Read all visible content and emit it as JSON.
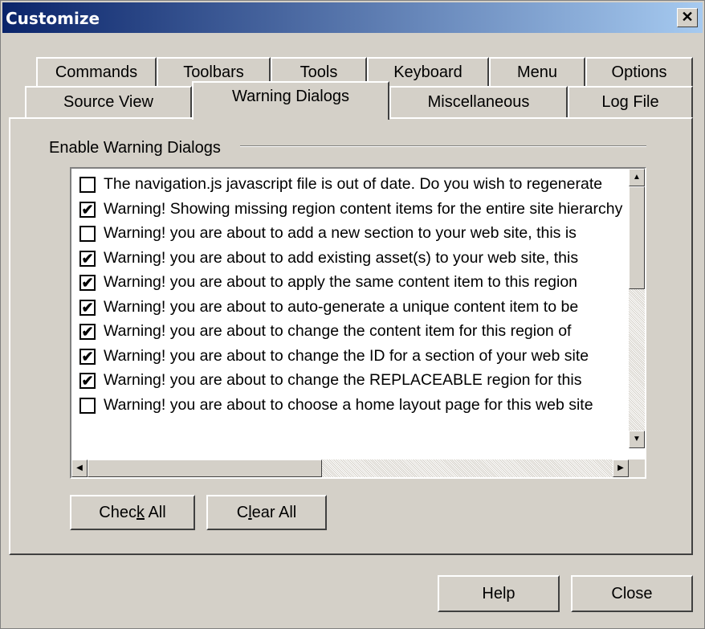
{
  "window": {
    "title": "Customize",
    "close_glyph": "✕"
  },
  "tabs_row1": [
    "Commands",
    "Toolbars",
    "Tools",
    "Keyboard",
    "Menu",
    "Options"
  ],
  "tabs_row2": [
    "Source View",
    "Warning Dialogs",
    "Miscellaneous",
    "Log File"
  ],
  "active_tab": "Warning Dialogs",
  "group": {
    "label": "Enable Warning Dialogs"
  },
  "items": [
    {
      "checked": false,
      "text": "The navigation.js javascript file is out of date. Do you wish to regenerate"
    },
    {
      "checked": true,
      "text": "Warning! Showing missing region content items for the entire site hierarchy"
    },
    {
      "checked": false,
      "text": "Warning! you are about to add a new section to your web site, this is"
    },
    {
      "checked": true,
      "text": "Warning! you are about to add existing asset(s) to your web site, this"
    },
    {
      "checked": true,
      "text": "Warning! you are about to apply the same content item to this region"
    },
    {
      "checked": true,
      "text": "Warning! you are about to auto-generate a unique content item to be"
    },
    {
      "checked": true,
      "text": "Warning! you are about to change the content item for this region of"
    },
    {
      "checked": true,
      "text": "Warning! you are about to change the ID for a section of your web site"
    },
    {
      "checked": true,
      "text": "Warning! you are about to change the REPLACEABLE region for this"
    },
    {
      "checked": false,
      "text": "Warning! you are about to choose a home layout page for this web site"
    }
  ],
  "buttons": {
    "check_all": {
      "pre": "Chec",
      "accel": "k",
      "post": " All"
    },
    "clear_all": {
      "pre": "C",
      "accel": "l",
      "post": "ear All"
    },
    "help": "Help",
    "close": "Close"
  },
  "icons": {
    "scroll_up": "▲",
    "scroll_down": "▼",
    "scroll_left": "◀",
    "scroll_right": "▶",
    "check": "✔"
  }
}
